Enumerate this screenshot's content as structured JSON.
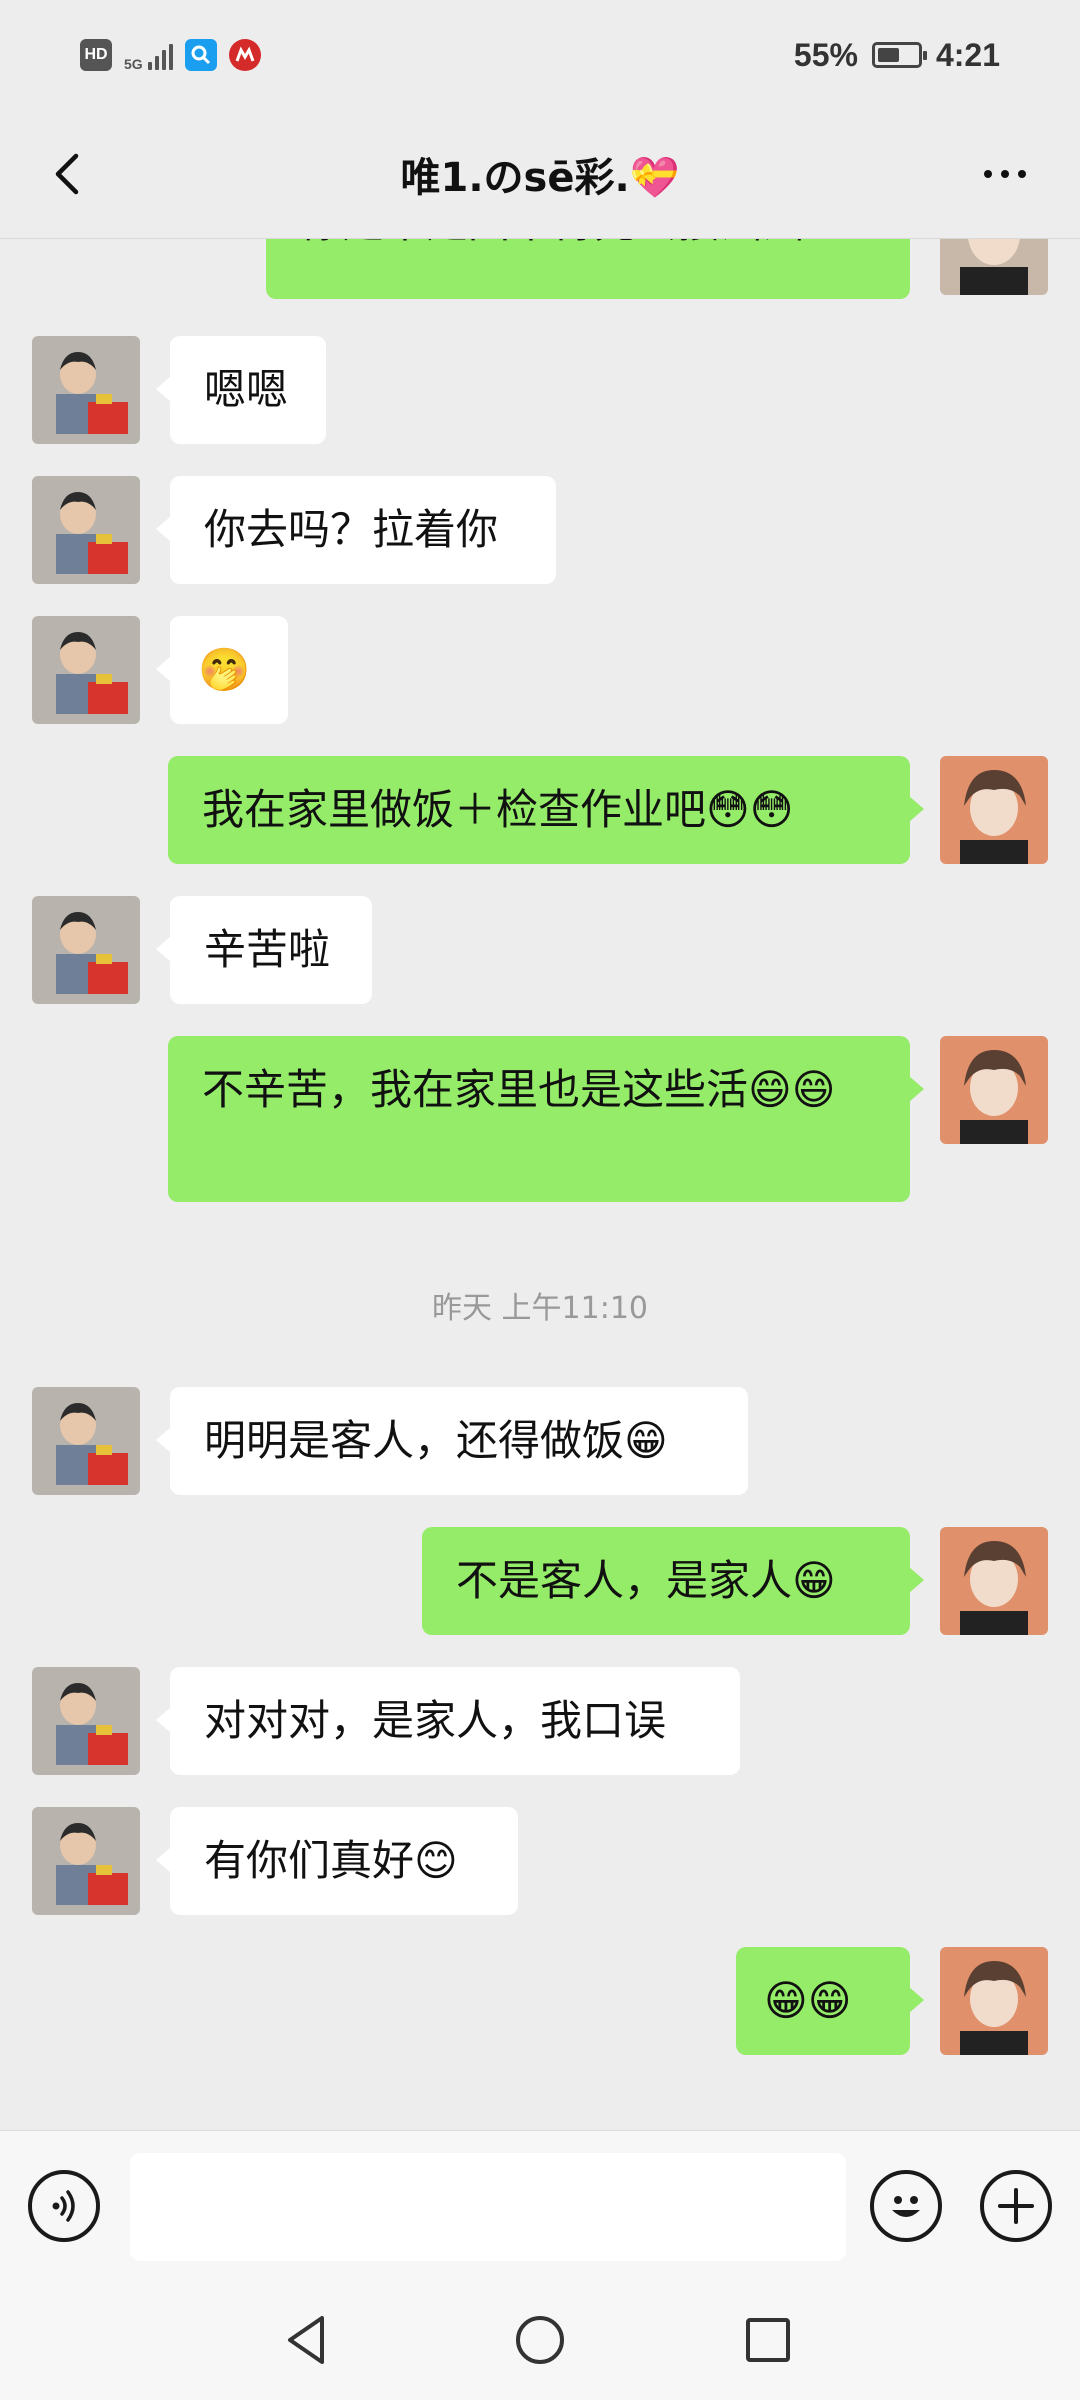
{
  "status_bar": {
    "icons": [
      "hd-icon",
      "signal-5g-icon",
      "search-app-icon",
      "red-app-icon"
    ],
    "hd_label": "HD",
    "net_label": "5G",
    "battery_percent": "55%",
    "battery_level": 0.55,
    "time": "4:21"
  },
  "header": {
    "title": "唯1.のsē彩.💝",
    "back_icon": "chevron-left-icon",
    "more_icon": "more-dots-icon"
  },
  "messages": [
    {
      "side": "right",
      "text": "你是不是回来得先去接涵涵？"
    },
    {
      "side": "left",
      "text": "嗯嗯"
    },
    {
      "side": "left",
      "text": "你去吗？拉着你"
    },
    {
      "side": "left",
      "text": "🤭"
    },
    {
      "side": "right",
      "text": "我在家里做饭＋检查作业吧😳😳"
    },
    {
      "side": "left",
      "text": "辛苦啦"
    },
    {
      "side": "right",
      "text": "不辛苦，我在家里也是这些活😄😄"
    },
    {
      "side": "left",
      "text": "明明是客人，还得做饭😁"
    },
    {
      "side": "right",
      "text": "不是客人，是家人😁"
    },
    {
      "side": "left",
      "text": "对对对，是家人，我口误"
    },
    {
      "side": "left",
      "text": "有你们真好😊"
    },
    {
      "side": "right",
      "text": "😁😁"
    }
  ],
  "timestamp": "昨天 上午11:10",
  "input_bar": {
    "voice_icon": "voice-icon",
    "emoji_icon": "emoji-icon",
    "plus_icon": "plus-icon",
    "text_value": ""
  },
  "system_nav": {
    "back": "triangle-back-icon",
    "home": "circle-home-icon",
    "recent": "square-recent-icon"
  },
  "colors": {
    "background": "#ededed",
    "bubble_self": "#95ec69",
    "bubble_other": "#ffffff"
  }
}
